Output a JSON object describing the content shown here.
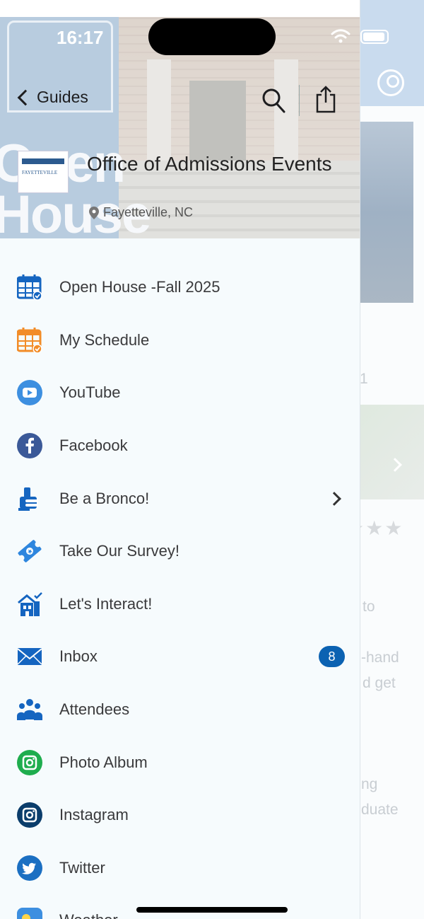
{
  "status_bar": {
    "time": "16:17"
  },
  "header": {
    "back_label": "Guides",
    "org_title": "Office of Admissions Events",
    "location": "Fayetteville, NC",
    "hero_banner_text": "Open House"
  },
  "menu": {
    "items": [
      {
        "label": "Open House -Fall 2025",
        "icon": "calendar-check-icon",
        "color": "#1565c0"
      },
      {
        "label": "My Schedule",
        "icon": "calendar-check-icon",
        "color": "#f28c28"
      },
      {
        "label": "YouTube",
        "icon": "youtube-icon",
        "color": "#3d8fe0"
      },
      {
        "label": "Facebook",
        "icon": "facebook-icon",
        "color": "#3b5998"
      },
      {
        "label": "Be a Bronco!",
        "icon": "thumbs-up-icon",
        "color": "#1565c0",
        "has_chevron": true
      },
      {
        "label": "Take Our Survey!",
        "icon": "ticket-icon",
        "color": "#2e86de"
      },
      {
        "label": "Let's Interact!",
        "icon": "building-icon",
        "color": "#1565c0"
      },
      {
        "label": "Inbox",
        "icon": "envelope-icon",
        "color": "#1565c0",
        "badge": "8"
      },
      {
        "label": "Attendees",
        "icon": "people-icon",
        "color": "#1565c0"
      },
      {
        "label": "Photo Album",
        "icon": "photo-icon",
        "color": "#1fad4e"
      },
      {
        "label": "Instagram",
        "icon": "instagram-icon",
        "color": "#0b3d6b"
      },
      {
        "label": "Twitter",
        "icon": "twitter-icon",
        "color": "#1b6fc2"
      },
      {
        "label": "Weather",
        "icon": "weather-icon",
        "color": "#3d8fe0"
      }
    ]
  },
  "background_page": {
    "text_lines": [
      "1",
      "to",
      "-hand",
      "d get",
      "ng",
      "duate"
    ]
  },
  "colors": {
    "accent": "#0b62b2",
    "badge": "#0b62b2",
    "drawer_bg": "#f6fbfd"
  }
}
